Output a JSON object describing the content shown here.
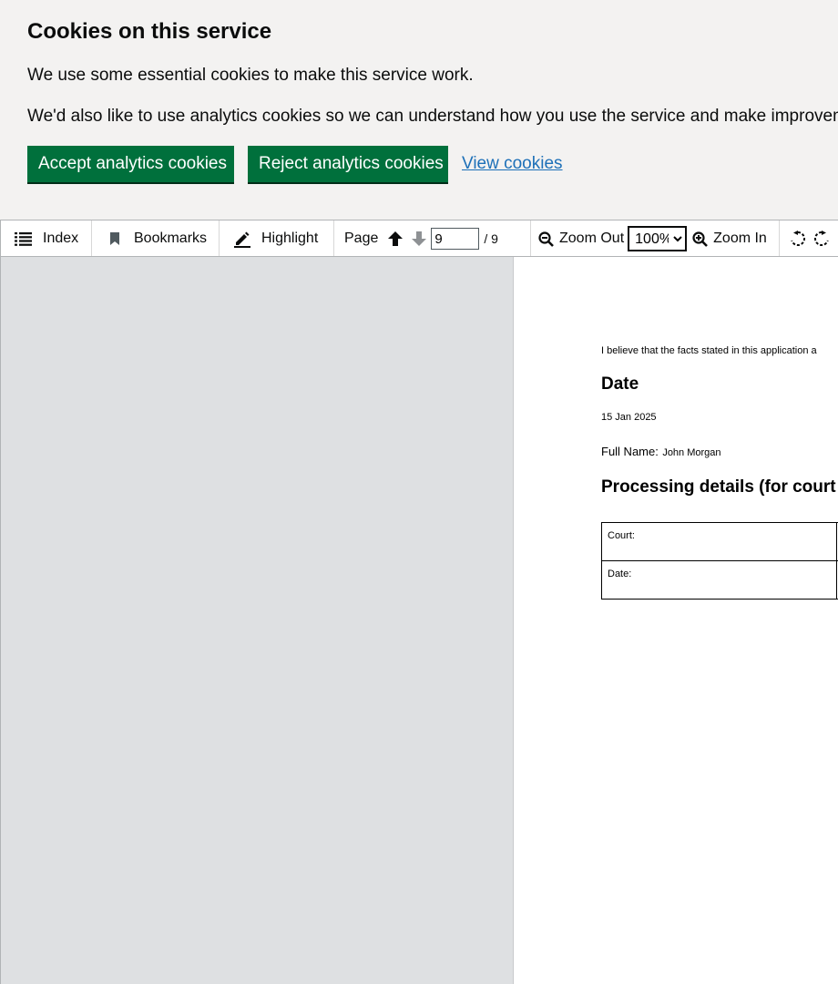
{
  "cookie_banner": {
    "title": "Cookies on this service",
    "paragraph_1": "We use some essential cookies to make this service work.",
    "paragraph_2": "We'd also like to use analytics cookies so we can understand how you use the service and make improvements.",
    "accept_label": "Accept analytics cookies",
    "reject_label": "Reject analytics cookies",
    "view_label": "View cookies",
    "colors": {
      "background": "#f3f2f1",
      "button": "#00703c",
      "link": "#1d70b8"
    }
  },
  "toolbar": {
    "index_label": "Index",
    "index_icon": "list-icon",
    "bookmarks_label": "Bookmarks",
    "bookmarks_icon": "bookmark-icon",
    "highlight_label": "Highlight",
    "highlight_icon": "pen-icon",
    "page_label": "Page",
    "current_page": "9",
    "total_pages": "/ 9",
    "zoom_out_label": "Zoom Out",
    "zoom_in_label": "Zoom In",
    "zoom_value": "100%",
    "zoom_options": [
      "100%"
    ]
  },
  "document": {
    "statement": "I believe that the facts stated in this application a",
    "date_heading": "Date",
    "date_value": "15 Jan 2025",
    "full_name_label": "Full Name:",
    "full_name_value": "John Morgan",
    "processing_heading": "Processing details (for court u",
    "table_rows": [
      {
        "label": "Court:"
      },
      {
        "label": "Date:"
      }
    ]
  }
}
